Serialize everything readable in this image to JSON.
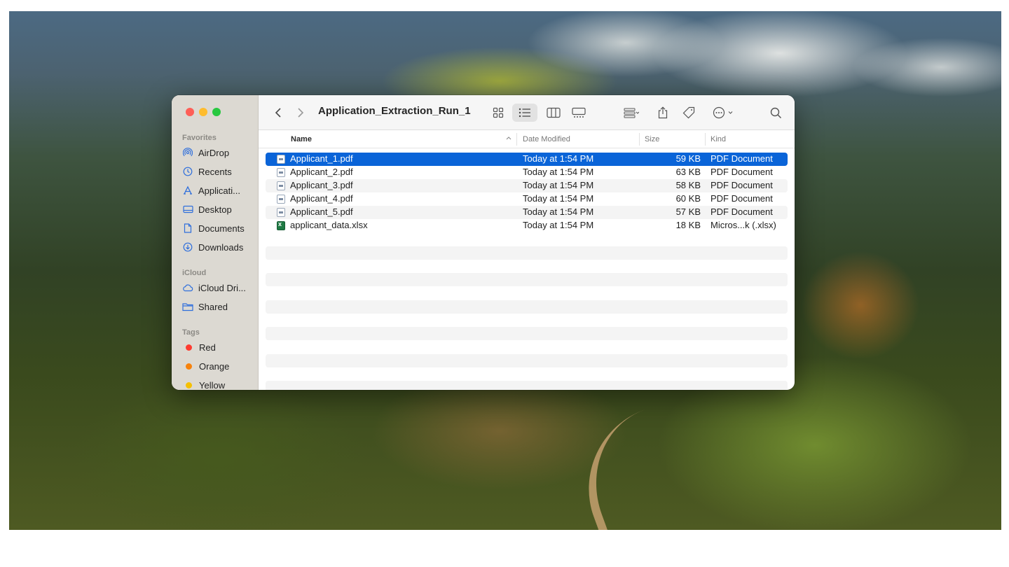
{
  "window": {
    "title": "Application_Extraction_Run_1"
  },
  "sidebar": {
    "sections": {
      "favorites": "Favorites",
      "icloud": "iCloud",
      "tags": "Tags"
    },
    "favorites": [
      {
        "label": "AirDrop",
        "icon": "airdrop-icon"
      },
      {
        "label": "Recents",
        "icon": "clock-icon"
      },
      {
        "label": "Applicati...",
        "icon": "applications-icon"
      },
      {
        "label": "Desktop",
        "icon": "desktop-icon"
      },
      {
        "label": "Documents",
        "icon": "document-icon"
      },
      {
        "label": "Downloads",
        "icon": "download-icon"
      }
    ],
    "icloud": [
      {
        "label": "iCloud Dri...",
        "icon": "cloud-icon"
      },
      {
        "label": "Shared",
        "icon": "shared-folder-icon"
      }
    ],
    "tags": [
      {
        "label": "Red",
        "color": "#fe3b30"
      },
      {
        "label": "Orange",
        "color": "#f7820c"
      },
      {
        "label": "Yellow",
        "color": "#f5c000"
      }
    ]
  },
  "columns": {
    "name": "Name",
    "date": "Date Modified",
    "size": "Size",
    "kind": "Kind"
  },
  "files": [
    {
      "name": "Applicant_1.pdf",
      "date": "Today at 1:54 PM",
      "size": "59 KB",
      "kind": "PDF Document",
      "type": "pdf",
      "selected": true
    },
    {
      "name": "Applicant_2.pdf",
      "date": "Today at 1:54 PM",
      "size": "63 KB",
      "kind": "PDF Document",
      "type": "pdf",
      "selected": false
    },
    {
      "name": "Applicant_3.pdf",
      "date": "Today at 1:54 PM",
      "size": "58 KB",
      "kind": "PDF Document",
      "type": "pdf",
      "selected": false
    },
    {
      "name": "Applicant_4.pdf",
      "date": "Today at 1:54 PM",
      "size": "60 KB",
      "kind": "PDF Document",
      "type": "pdf",
      "selected": false
    },
    {
      "name": "Applicant_5.pdf",
      "date": "Today at 1:54 PM",
      "size": "57 KB",
      "kind": "PDF Document",
      "type": "pdf",
      "selected": false
    },
    {
      "name": "applicant_data.xlsx",
      "date": "Today at 1:54 PM",
      "size": "18 KB",
      "kind": "Micros...k (.xlsx)",
      "type": "xlsx",
      "selected": false
    }
  ],
  "colors": {
    "selection": "#0a64d8",
    "accent": "#2f6fdc"
  }
}
